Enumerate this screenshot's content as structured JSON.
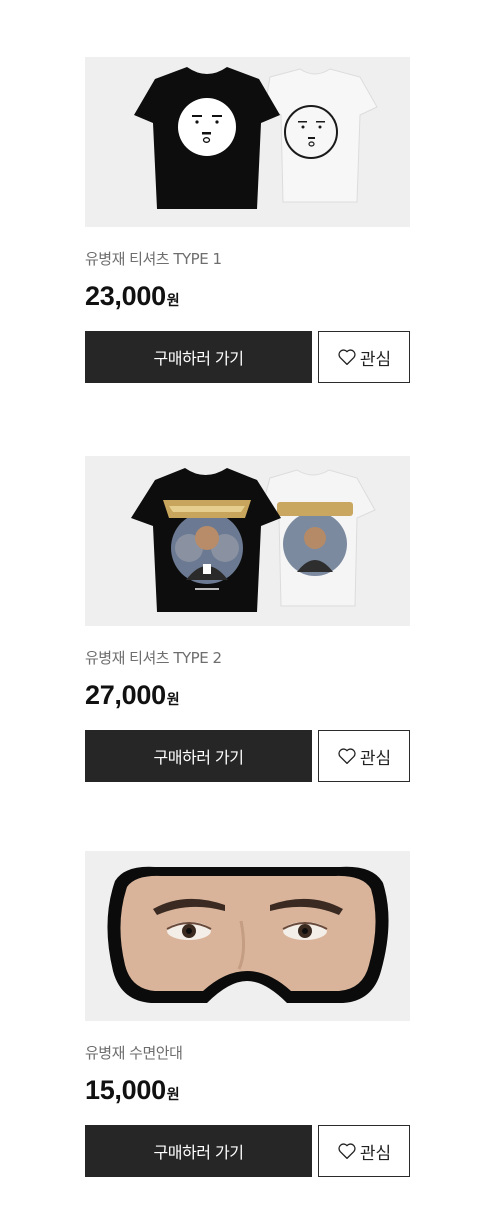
{
  "products": [
    {
      "name": "유병재 티셔츠 TYPE 1",
      "price": "23,000",
      "currency": "원",
      "buy_label": "구매하러 가기",
      "wish_label": "관심",
      "image": "t-shirts-face-print"
    },
    {
      "name": "유병재 티셔츠 TYPE 2",
      "price": "27,000",
      "currency": "원",
      "buy_label": "구매하러 가기",
      "wish_label": "관심",
      "image": "t-shirts-graphic-print"
    },
    {
      "name": "유병재 수면안대",
      "price": "15,000",
      "currency": "원",
      "buy_label": "구매하러 가기",
      "wish_label": "관심",
      "image": "sleep-mask-eyes"
    }
  ],
  "icons": {
    "wish": "heart-outline-icon"
  }
}
